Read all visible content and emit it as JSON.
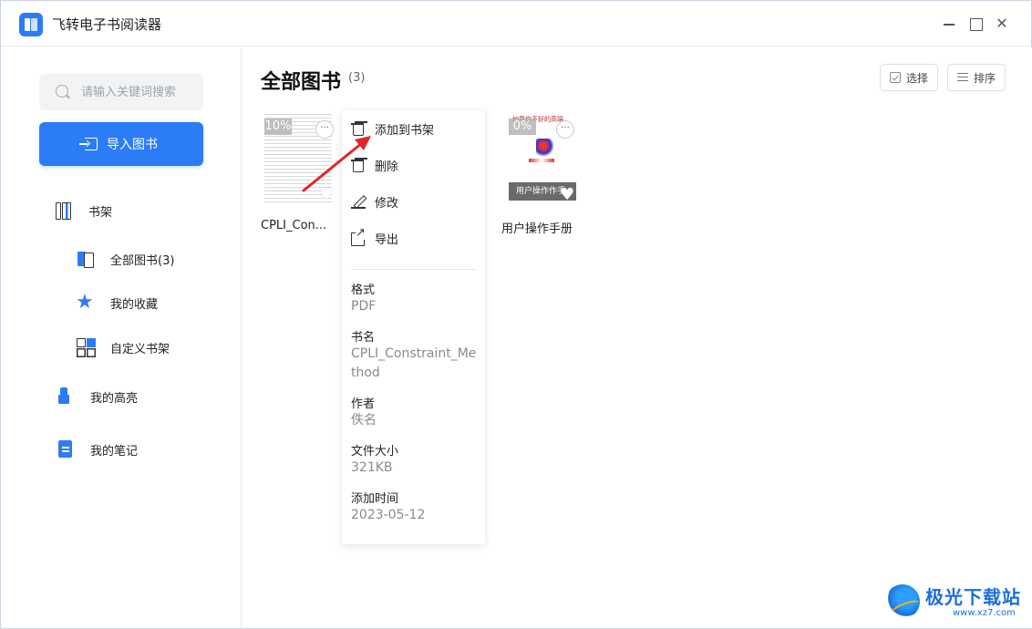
{
  "app": {
    "title": "飞转电子书阅读器",
    "window_controls": [
      "minimize-icon",
      "maximize-icon",
      "close-icon"
    ]
  },
  "sidebar": {
    "search_placeholder": "请输入关键词搜索",
    "import_button": "导入图书",
    "items": [
      {
        "label": "书架",
        "icon": "bookshelf-icon"
      },
      {
        "label": "全部图书(3)",
        "icon": "all-books-icon"
      },
      {
        "label": "我的收藏",
        "icon": "favorite-star-icon"
      },
      {
        "label": "自定义书架",
        "icon": "custom-shelf-grid-icon"
      },
      {
        "label": "我的高亮",
        "icon": "highlighter-icon"
      },
      {
        "label": "我的笔记",
        "icon": "notebook-icon"
      }
    ]
  },
  "main": {
    "title": "全部图书",
    "count": "(3)",
    "toolbar": {
      "select_label": "选择",
      "sort_label": "排序"
    },
    "books": [
      {
        "title": "CPLI_Con...",
        "progress": "10%",
        "cover_text": ""
      },
      {
        "title": "用户操作手册",
        "progress": "0%",
        "cover_text": "用户操作作手",
        "cover_header": "如果你不好的高端"
      }
    ]
  },
  "context_menu": {
    "items": [
      {
        "label": "添加到书架",
        "icon": "trash-icon"
      },
      {
        "label": "删除",
        "icon": "trash-icon"
      },
      {
        "label": "修改",
        "icon": "edit-pencil-icon"
      },
      {
        "label": "导出",
        "icon": "export-icon"
      }
    ],
    "info": [
      {
        "label": "格式",
        "value": "PDF"
      },
      {
        "label": "书名",
        "value": "CPLI_Constraint_Method"
      },
      {
        "label": "作者",
        "value": "佚名"
      },
      {
        "label": "文件大小",
        "value": "321KB"
      },
      {
        "label": "添加时间",
        "value": "2023-05-12"
      }
    ]
  },
  "watermark": {
    "text": "极光下载站",
    "url": "www.xz7.com"
  },
  "colors": {
    "accent": "#2b7cf6",
    "annotation_arrow": "#e0262b"
  }
}
